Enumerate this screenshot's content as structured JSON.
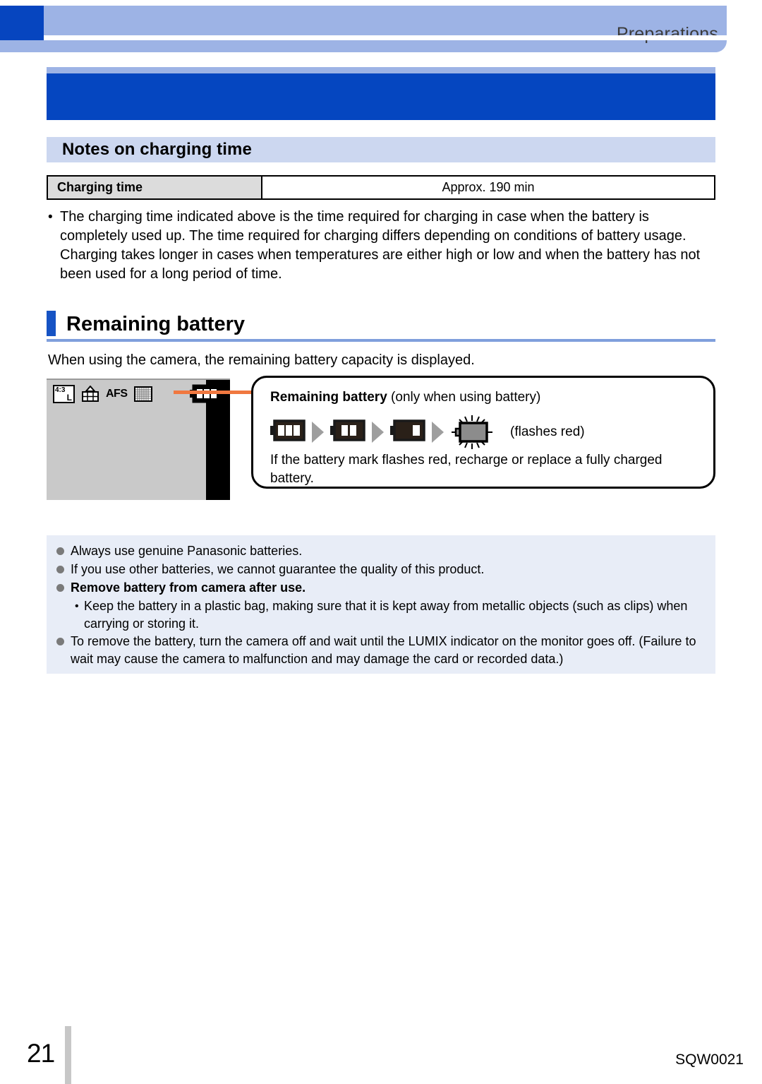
{
  "header": {
    "title": "Preparations",
    "tab_icon": "chapter-tab"
  },
  "subheading": {
    "text": "Notes on charging time"
  },
  "spec_table": {
    "label": "Charging time",
    "value": "Approx. 190 min"
  },
  "charging_note": {
    "bullet": "•",
    "text": "The charging time indicated above is the time required for charging in case when the battery is completely used up. The time required for charging differs depending on conditions of battery usage. Charging takes longer in cases when temperatures are either high or low and when the battery has not been used for a long period of time."
  },
  "section": {
    "title": "Remaining battery",
    "lead": "When using the camera, the remaining battery capacity is displayed."
  },
  "monitor": {
    "aspect_top": "4:3",
    "aspect_size": "L",
    "quality_icon": "picture-quality-fine-icon",
    "focus_mode": "AFS",
    "grid_icon": "grid-display-icon",
    "battery_icon": "battery-full-icon"
  },
  "callout": {
    "title_bold": "Remaining battery",
    "title_rest": " (only when using battery)",
    "states": [
      {
        "name": "battery-3-bars-icon",
        "bars": 3
      },
      {
        "name": "battery-2-bars-icon",
        "bars": 2
      },
      {
        "name": "battery-1-bar-icon",
        "bars": 1
      },
      {
        "name": "battery-empty-flashing-icon",
        "bars": 0
      }
    ],
    "flashes_label": "(flashes red)",
    "body": "If the battery mark flashes red, recharge or replace a fully charged battery."
  },
  "notes": [
    {
      "type": "bullet",
      "bold": false,
      "text": "Always use genuine Panasonic batteries."
    },
    {
      "type": "bullet",
      "bold": false,
      "text": "If you use other batteries, we cannot guarantee the quality of this product."
    },
    {
      "type": "bullet",
      "bold": true,
      "text": "Remove battery from camera after use."
    },
    {
      "type": "sub",
      "dot": "•",
      "text": "Keep the battery in a plastic bag, making sure that it is kept away from metallic objects (such as clips) when carrying or storing it."
    },
    {
      "type": "bullet",
      "bold": false,
      "text": "To remove the battery, turn the camera off and wait until the LUMIX indicator on the monitor goes off. (Failure to wait may cause the camera to malfunction and may damage the card or recorded data.)"
    }
  ],
  "footer": {
    "page_number": "21",
    "doc_code": "SQW0021"
  },
  "colors": {
    "chapter_blue": "#0546c0",
    "band_blue": "#9db3e5",
    "subhead_blue": "#ccd7f0",
    "notes_blue": "#e8edf7",
    "accent_orange": "#f07840",
    "section_accent": "#1653c4"
  }
}
